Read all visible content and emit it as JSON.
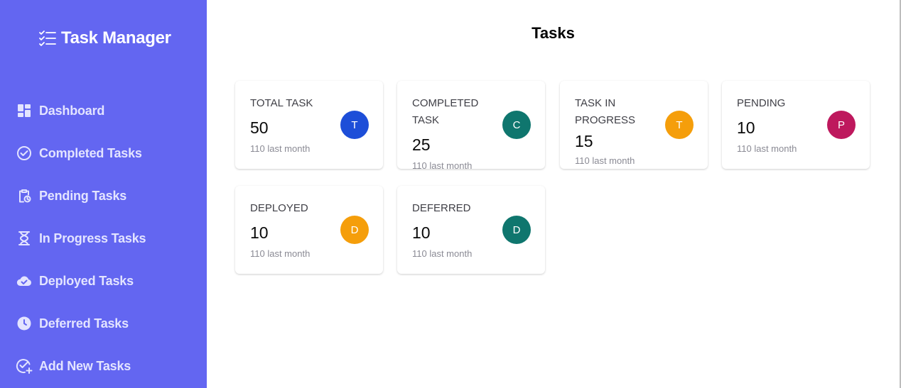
{
  "sidebar": {
    "brand": {
      "title": "Task Manager",
      "icon": "checklist-icon"
    },
    "items": [
      {
        "label": "Dashboard",
        "icon": "dashboard-icon"
      },
      {
        "label": "Completed Tasks",
        "icon": "check-circle-icon"
      },
      {
        "label": "Pending Tasks",
        "icon": "clipboard-clock-icon"
      },
      {
        "label": "In Progress Tasks",
        "icon": "hourglass-icon"
      },
      {
        "label": "Deployed Tasks",
        "icon": "cloud-check-icon"
      },
      {
        "label": "Deferred Tasks",
        "icon": "clock-icon"
      },
      {
        "label": "Add New Tasks",
        "icon": "check-add-icon"
      }
    ],
    "colors": {
      "background": "#6366f1"
    }
  },
  "main": {
    "title": "Tasks",
    "cards": [
      {
        "label": "TOTAL TASK",
        "value": "50",
        "sub": "110 last month",
        "avatar": "T",
        "avatar_color": "#1d4ed8"
      },
      {
        "label": "COMPLETED TASK",
        "value": "25",
        "sub": "110 last month",
        "avatar": "C",
        "avatar_color": "#0f766e"
      },
      {
        "label": "TASK IN PROGRESS",
        "value": "15",
        "sub": "110 last month",
        "avatar": "T",
        "avatar_color": "#f59e0b"
      },
      {
        "label": "PENDING",
        "value": "10",
        "sub": "110 last month",
        "avatar": "P",
        "avatar_color": "#be185d"
      },
      {
        "label": "DEPLOYED",
        "value": "10",
        "sub": "110 last month",
        "avatar": "D",
        "avatar_color": "#f59e0b"
      },
      {
        "label": "DEFERRED",
        "value": "10",
        "sub": "110 last month",
        "avatar": "D",
        "avatar_color": "#0f766e"
      }
    ]
  }
}
